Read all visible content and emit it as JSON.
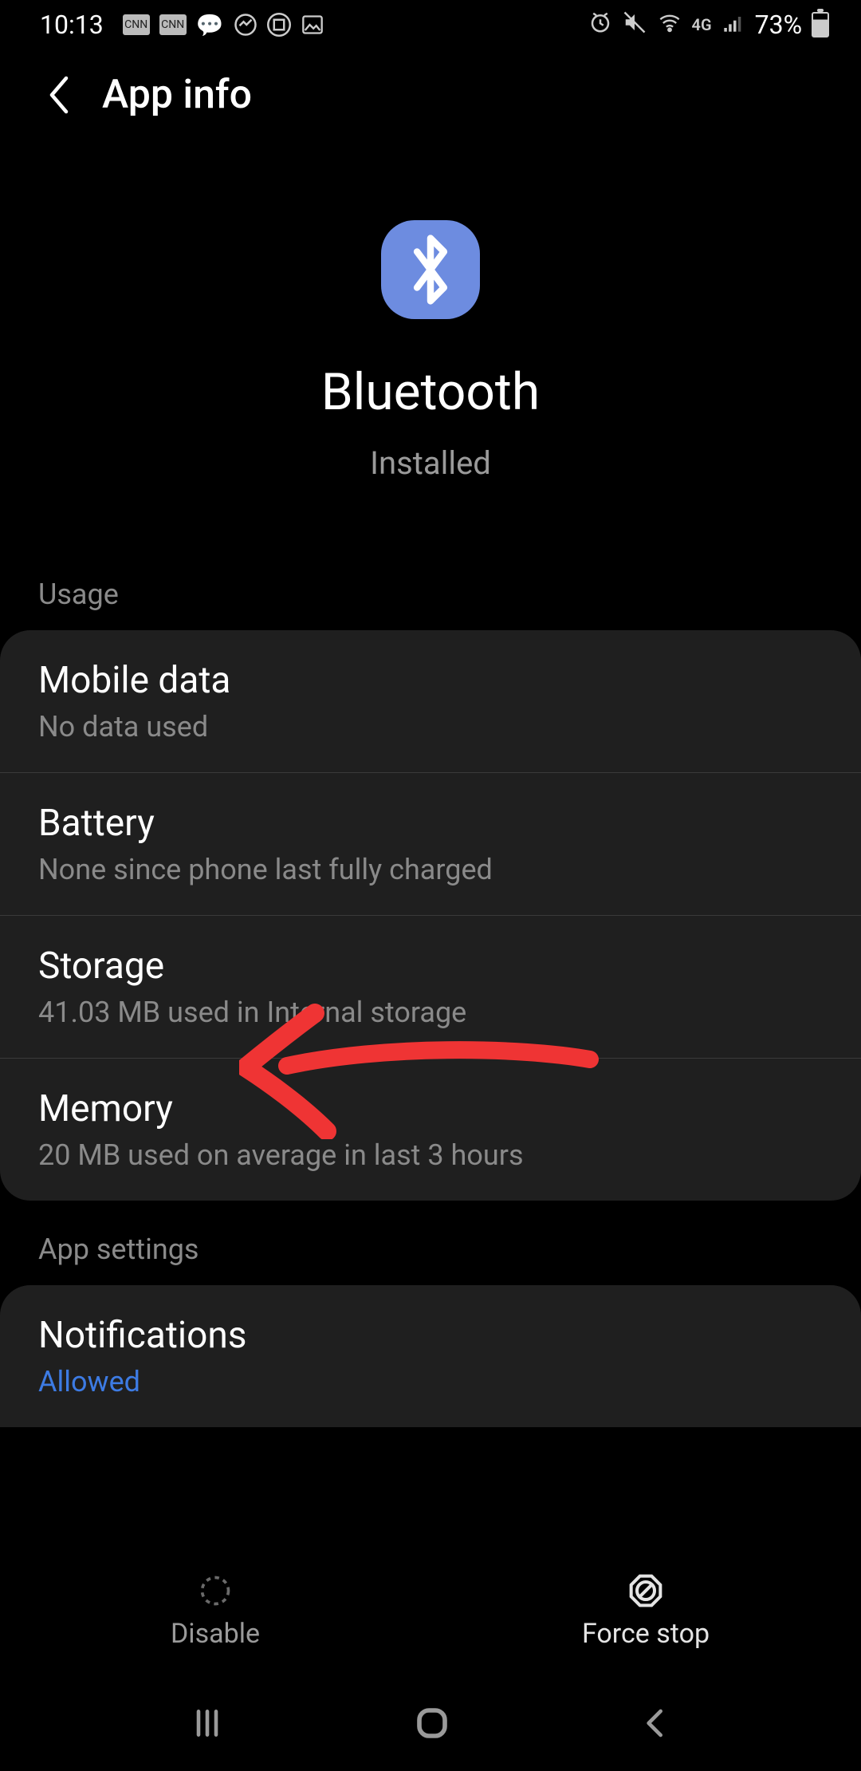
{
  "status": {
    "time": "10:13",
    "left_icons": [
      "cnn-icon",
      "cnn-icon",
      "chat-icon",
      "messenger-icon",
      "app-icon",
      "image-icon"
    ],
    "right_icons": [
      "alarm-icon",
      "mute-vibrate-icon",
      "wifi-icon",
      "4g-icon",
      "signal-icon"
    ],
    "battery_pct": "73%"
  },
  "header": {
    "title": "App info"
  },
  "app": {
    "name": "Bluetooth",
    "status": "Installed"
  },
  "sections": {
    "usage": {
      "title": "Usage",
      "items": [
        {
          "title": "Mobile data",
          "sub": "No data used"
        },
        {
          "title": "Battery",
          "sub": "None since phone last fully charged"
        },
        {
          "title": "Storage",
          "sub": "41.03 MB used in Internal storage"
        },
        {
          "title": "Memory",
          "sub": "20 MB used on average in last 3 hours"
        }
      ]
    },
    "app_settings": {
      "title": "App settings",
      "items": [
        {
          "title": "Notifications",
          "sub": "Allowed"
        }
      ]
    }
  },
  "bottom_bar": {
    "disable": "Disable",
    "force_stop": "Force stop"
  }
}
